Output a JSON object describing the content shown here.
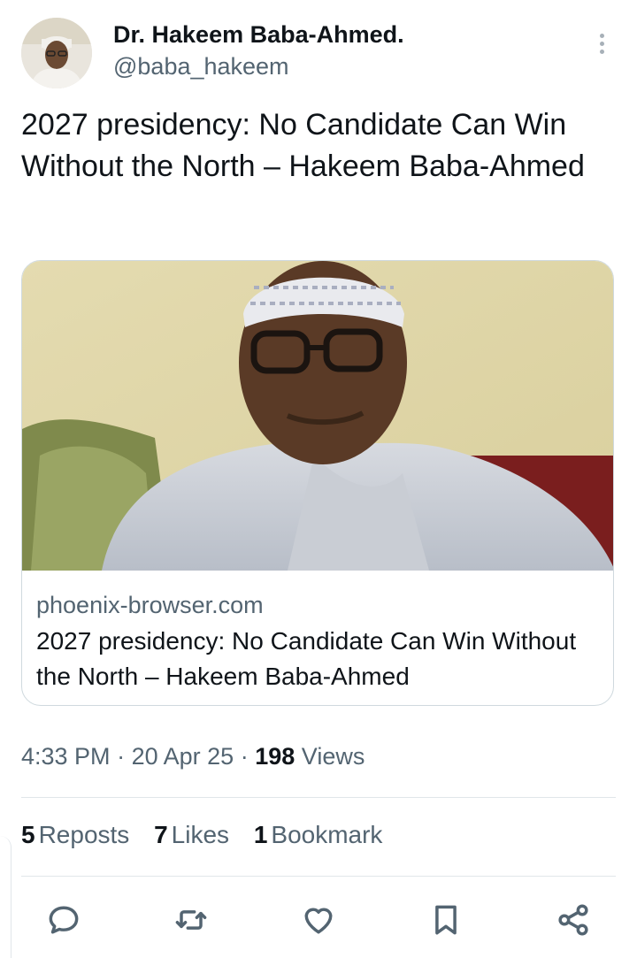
{
  "author": {
    "name": "Dr. Hakeem Baba-Ahmed.",
    "handle": "@baba_hakeem"
  },
  "tweet": {
    "text": "2027 presidency: No Candidate Can Win Without the North – Hakeem Baba-Ahmed"
  },
  "card": {
    "domain": "phoenix-browser.com",
    "title": "2027 presidency: No Candidate Can Win Without the North – Hakeem Baba-Ahmed"
  },
  "meta": {
    "time": "4:33 PM",
    "date": "20 Apr 25",
    "views_count": "198",
    "views_label": "Views",
    "separator": "·"
  },
  "stats": {
    "reposts_count": "5",
    "reposts_label": "Reposts",
    "likes_count": "7",
    "likes_label": "Likes",
    "bookmarks_count": "1",
    "bookmarks_label": "Bookmark"
  },
  "icons": {
    "more": "more-vertical-icon",
    "reply": "reply-icon",
    "repost": "repost-icon",
    "like": "heart-icon",
    "bookmark": "bookmark-icon",
    "share": "share-icon"
  },
  "colors": {
    "text": "#0f1419",
    "secondary": "#536471",
    "icon": "#536471",
    "border": "#cfd9de"
  }
}
